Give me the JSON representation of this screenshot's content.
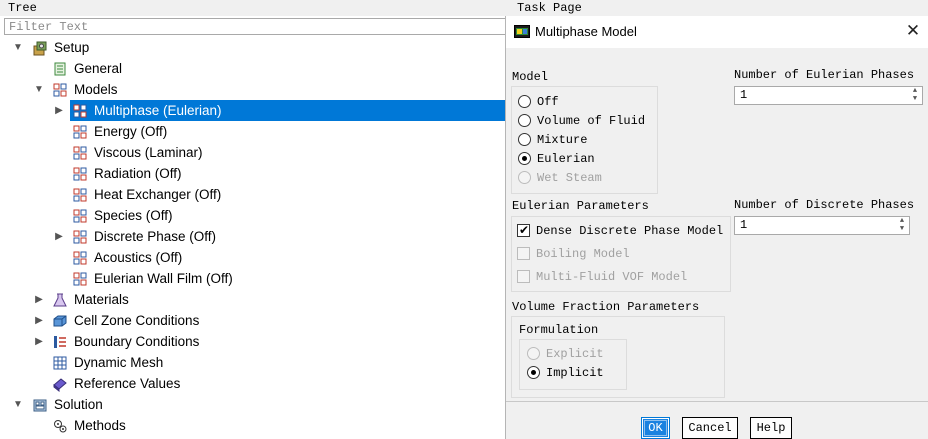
{
  "tree_header": "Tree",
  "task_header": "Task Page",
  "filter": {
    "placeholder": "Filter Text",
    "value": ""
  },
  "tree": {
    "setup": "Setup",
    "general": "General",
    "models": "Models",
    "multiphase": "Multiphase (Eulerian)",
    "energy": "Energy (Off)",
    "viscous": "Viscous (Laminar)",
    "radiation": "Radiation (Off)",
    "heat_exchanger": "Heat Exchanger (Off)",
    "species": "Species (Off)",
    "discrete_phase": "Discrete Phase (Off)",
    "acoustics": "Acoustics (Off)",
    "eulerian_wall_film": "Eulerian Wall Film (Off)",
    "materials": "Materials",
    "cell_zone": "Cell Zone Conditions",
    "boundary": "Boundary Conditions",
    "dynamic_mesh": "Dynamic Mesh",
    "reference_values": "Reference Values",
    "solution": "Solution",
    "methods": "Methods"
  },
  "dialog": {
    "title": "Multiphase Model",
    "model_label": "Model",
    "models": [
      {
        "label": "Off",
        "checked": false,
        "disabled": false
      },
      {
        "label": "Volume of Fluid",
        "checked": false,
        "disabled": false
      },
      {
        "label": "Mixture",
        "checked": false,
        "disabled": false
      },
      {
        "label": "Eulerian",
        "checked": true,
        "disabled": false
      },
      {
        "label": "Wet Steam",
        "checked": false,
        "disabled": true
      }
    ],
    "num_eulerian_label": "Number of Eulerian Phases",
    "num_eulerian_value": "1",
    "eulerian_params_label": "Eulerian Parameters",
    "eulerian_params": [
      {
        "label": "Dense Discrete Phase Model",
        "checked": true,
        "disabled": false
      },
      {
        "label": "Boiling Model",
        "checked": false,
        "disabled": true
      },
      {
        "label": "Multi-Fluid VOF Model",
        "checked": false,
        "disabled": true
      }
    ],
    "num_discrete_label": "Number of Discrete Phases",
    "num_discrete_value": "1",
    "vf_params_label": "Volume Fraction Parameters",
    "formulation_label": "Formulation",
    "formulations": [
      {
        "label": "Explicit",
        "checked": false,
        "disabled": true
      },
      {
        "label": "Implicit",
        "checked": true,
        "disabled": false
      }
    ],
    "buttons": {
      "ok": "OK",
      "cancel": "Cancel",
      "help": "Help"
    }
  },
  "colors": {
    "selection": "#0078d7",
    "dialog_bg": "#f0f0f0",
    "primary_button": "#1a82e0"
  }
}
